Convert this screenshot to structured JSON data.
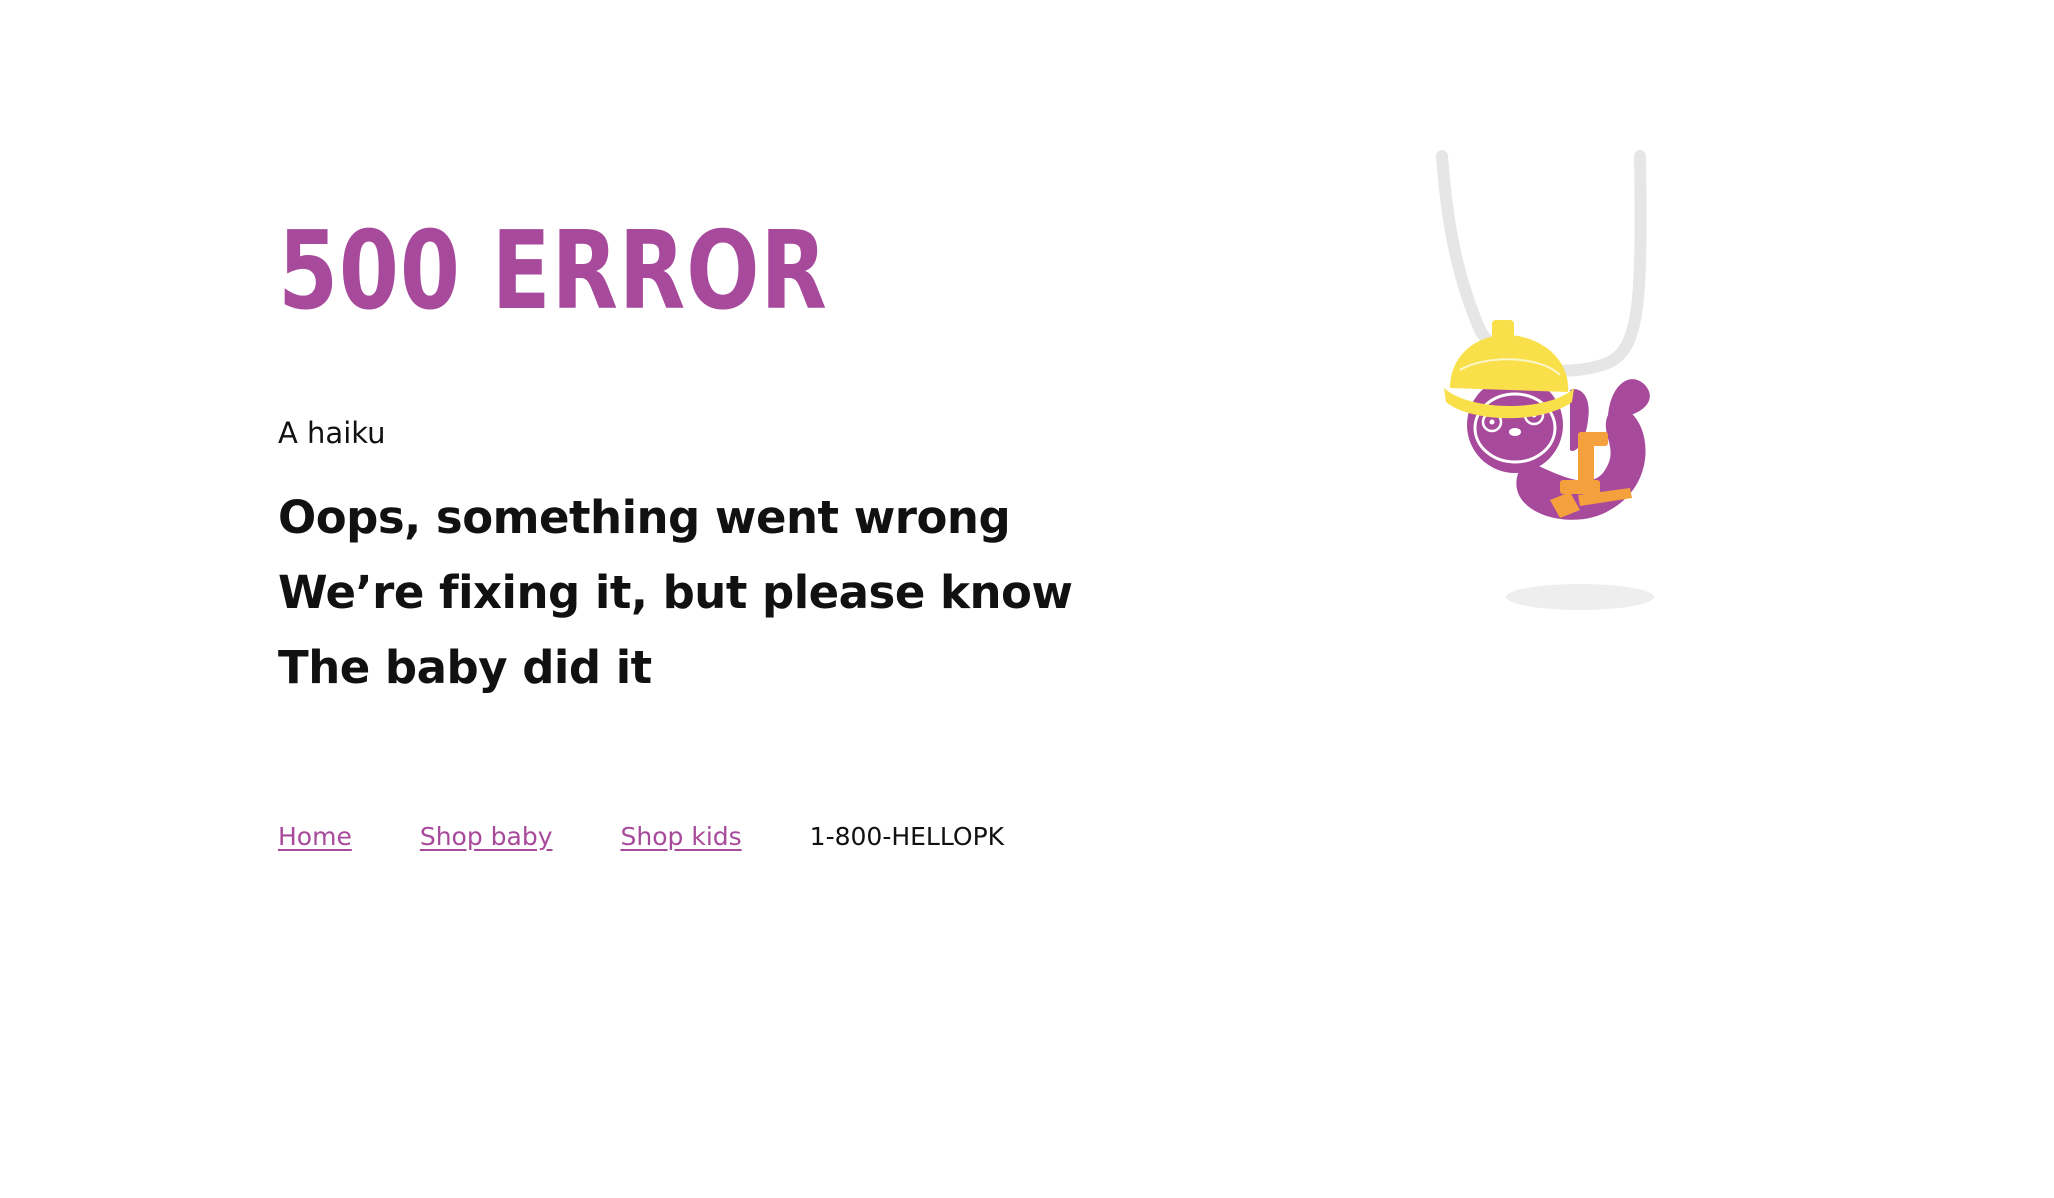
{
  "page": {
    "title": "500 ERROR",
    "haiku_label": "A haiku",
    "haiku_lines": [
      "Oops, something went wrong",
      "We’re fixing it, but please know",
      "The baby did it"
    ]
  },
  "footer": {
    "links": [
      {
        "label": "Home"
      },
      {
        "label": "Shop baby"
      },
      {
        "label": "Shop kids"
      }
    ],
    "phone": "1-800-HELLOPK"
  },
  "illustration": {
    "icon": "sloth-hardhat-icon"
  },
  "colors": {
    "accent": "#a84a9c",
    "text": "#111111",
    "helmet": "#f9e04b",
    "tool": "#f4a03c",
    "rope": "#e6e6e6"
  }
}
